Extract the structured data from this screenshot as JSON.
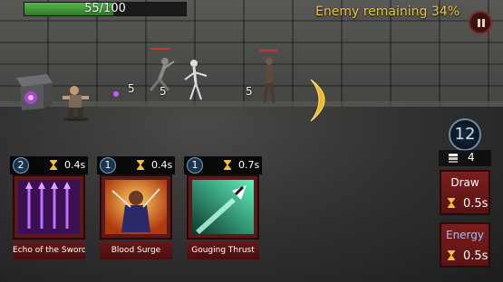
{
  "hud": {
    "hp_text": "55/100",
    "hp_fraction": 0.55,
    "enemy_remaining": "Enemy remaining 34%"
  },
  "battle": {
    "damage_numbers": [
      "5",
      "5",
      "5"
    ]
  },
  "side_panel": {
    "mana": "12",
    "deck_count": "4",
    "draw": {
      "label": "Draw",
      "time": "0.5s"
    },
    "energy": {
      "label": "Energy",
      "time": "0.5s"
    }
  },
  "cards": [
    {
      "cost": "2",
      "cooldown": "0.4s",
      "name": "Echo of the Sword",
      "art_color": "#6a2a8a"
    },
    {
      "cost": "1",
      "cooldown": "0.4s",
      "name": "Blood Surge",
      "art_color": "#e07a2a"
    },
    {
      "cost": "1",
      "cooldown": "0.7s",
      "name": "Gouging Thrust",
      "art_color": "#3cd0a0"
    }
  ],
  "colors": {
    "accent": "#f0c23a",
    "hp_green": "#56b84a",
    "card_red": "#6a1616"
  }
}
